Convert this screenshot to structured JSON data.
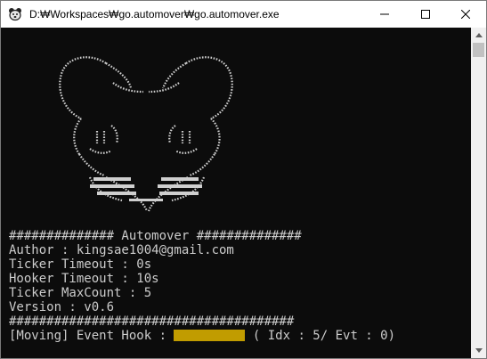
{
  "window": {
    "title": "D:₩Workspaces₩go.automover₩go.automover.exe"
  },
  "console": {
    "lines": [
      "############## Automover ##############",
      "Author : kingsae1004@gmail.com",
      "Ticker Timeout : 0s",
      "Hooker Timeout : 10s",
      "Ticker MaxCount : 5",
      "Version : v0.6",
      "######################################"
    ],
    "status": {
      "prefix": "[Moving] Event Hook : ",
      "suffix": " ( Idx : 5/ Evt : 0)",
      "bar_color": "#c19c00"
    }
  },
  "icons": {
    "app": "app-icon",
    "minimize": "minimize-icon",
    "maximize": "maximize-icon",
    "close": "close-icon",
    "scroll_up": "scroll-up-arrow-icon",
    "scroll_down": "scroll-down-arrow-icon"
  }
}
